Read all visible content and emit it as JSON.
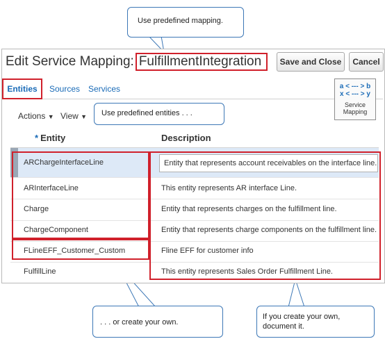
{
  "callouts": {
    "top": "Use predefined  mapping.",
    "entities": "Use predefined  entities . . .",
    "create": ". . . or create your own.",
    "document": "If you create your own, document it."
  },
  "header": {
    "title_prefix": "Edit Service Mapping:",
    "title_name": "FulfillmentIntegration",
    "save_close": "Save and Close",
    "cancel": "Cancel"
  },
  "tabs": [
    {
      "label": "Entities",
      "active": true
    },
    {
      "label": "Sources",
      "active": false
    },
    {
      "label": "Services",
      "active": false
    }
  ],
  "service_mapping_icon": {
    "line1": "a < --- > b",
    "line2": "x < --- > y",
    "label1": "Service",
    "label2": "Mapping"
  },
  "toolbar": {
    "actions": "Actions",
    "view": "View"
  },
  "table": {
    "required_marker": "*",
    "col_entity": "Entity",
    "col_description": "Description",
    "rows": [
      {
        "entity": "ARChargeInterfaceLine",
        "description": "Entity that represents account receivables on the interface line."
      },
      {
        "entity": "ARInterfaceLine",
        "description": "This entity represents AR interface Line."
      },
      {
        "entity": "Charge",
        "description": "Entity that represents charges on the fulfillment line."
      },
      {
        "entity": "ChargeComponent",
        "description": "Entity that represents charge components on the fulfillment line."
      },
      {
        "entity": "FLineEFF_Customer_Custom",
        "description": "Fline EFF for customer info"
      },
      {
        "entity": "FulfillLine",
        "description": "This entity represents Sales Order Fulfillment Line."
      }
    ]
  },
  "colors": {
    "highlight": "#d0202b",
    "callout_border": "#3c77b6",
    "link": "#1a6bb7"
  }
}
